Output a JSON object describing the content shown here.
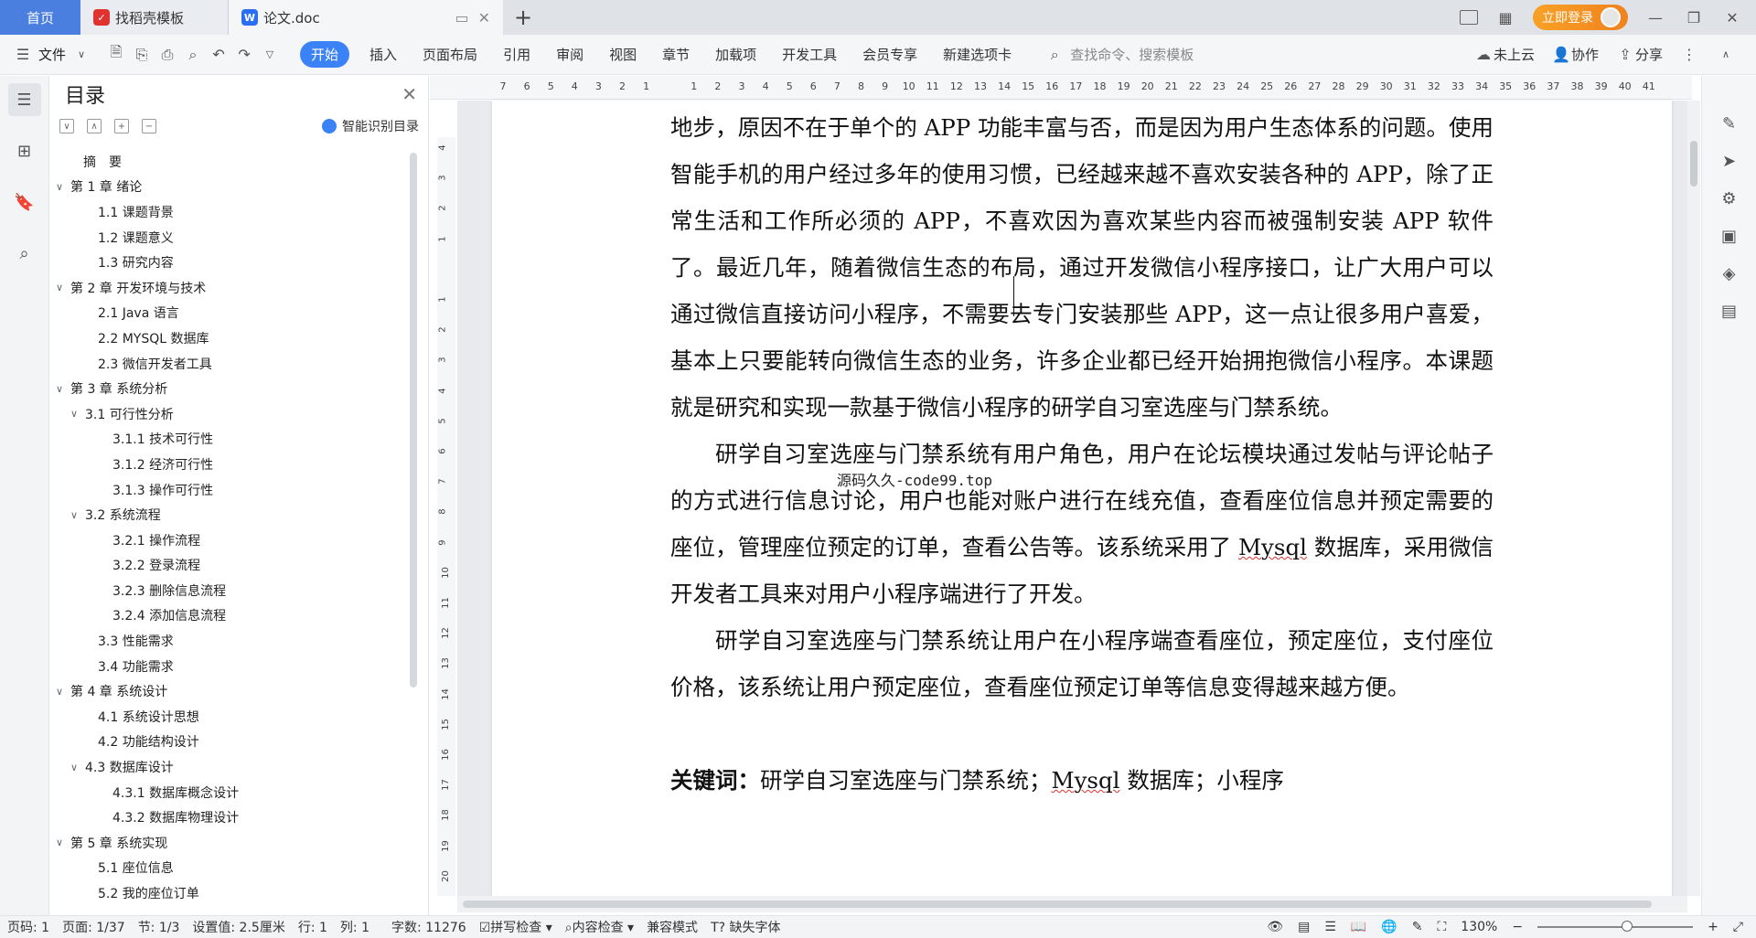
{
  "tabs": {
    "home": "首页",
    "template": "找稻壳模板",
    "doc": "论文.doc",
    "login": "立即登录"
  },
  "menu": {
    "file": "文件",
    "items": [
      "开始",
      "插入",
      "页面布局",
      "引用",
      "审阅",
      "视图",
      "章节",
      "加载项",
      "开发工具",
      "会员专享",
      "新建选项卡"
    ],
    "active": "开始",
    "search_placeholder": "查找命令、搜索模板",
    "cloud": "未上云",
    "collab": "协作",
    "share": "分享"
  },
  "toc": {
    "title": "目录",
    "smart": "智能识别目录",
    "items": [
      {
        "label": "摘　要",
        "level": 1,
        "chev": ""
      },
      {
        "label": "第 1 章  绪论",
        "level": 1,
        "chev": "v"
      },
      {
        "label": "1.1  课题背景",
        "level": 2,
        "chev": ""
      },
      {
        "label": "1.2  课题意义",
        "level": 2,
        "chev": ""
      },
      {
        "label": "1.3  研究内容",
        "level": 2,
        "chev": ""
      },
      {
        "label": "第 2 章  开发环境与技术",
        "level": 1,
        "chev": "v"
      },
      {
        "label": "2.1 Java 语言",
        "level": 2,
        "chev": ""
      },
      {
        "label": "2.2 MYSQL 数据库",
        "level": 2,
        "chev": ""
      },
      {
        "label": "2.3 微信开发者工具",
        "level": 2,
        "chev": ""
      },
      {
        "label": "第 3 章  系统分析",
        "level": 1,
        "chev": "v"
      },
      {
        "label": "3.1  可行性分析",
        "level": 2,
        "chev": "v"
      },
      {
        "label": "3.1.1  技术可行性",
        "level": 3,
        "chev": ""
      },
      {
        "label": "3.1.2  经济可行性",
        "level": 3,
        "chev": ""
      },
      {
        "label": "3.1.3  操作可行性",
        "level": 3,
        "chev": ""
      },
      {
        "label": "3.2  系统流程",
        "level": 2,
        "chev": "v"
      },
      {
        "label": "3.2.1  操作流程",
        "level": 3,
        "chev": ""
      },
      {
        "label": "3.2.2  登录流程",
        "level": 3,
        "chev": ""
      },
      {
        "label": "3.2.3  删除信息流程",
        "level": 3,
        "chev": ""
      },
      {
        "label": "3.2.4  添加信息流程",
        "level": 3,
        "chev": ""
      },
      {
        "label": "3.3  性能需求",
        "level": 2,
        "chev": ""
      },
      {
        "label": "3.4  功能需求",
        "level": 2,
        "chev": ""
      },
      {
        "label": "第 4 章  系统设计",
        "level": 1,
        "chev": "v"
      },
      {
        "label": "4.1  系统设计思想",
        "level": 2,
        "chev": ""
      },
      {
        "label": "4.2  功能结构设计",
        "level": 2,
        "chev": ""
      },
      {
        "label": "4.3  数据库设计",
        "level": 2,
        "chev": "v"
      },
      {
        "label": "4.3.1  数据库概念设计",
        "level": 3,
        "chev": ""
      },
      {
        "label": "4.3.2  数据库物理设计",
        "level": 3,
        "chev": ""
      },
      {
        "label": "第 5 章  系统实现",
        "level": 1,
        "chev": "v"
      },
      {
        "label": "5.1  座位信息",
        "level": 2,
        "chev": ""
      },
      {
        "label": "5.2  我的座位订单",
        "level": 2,
        "chev": ""
      }
    ]
  },
  "ruler": {
    "h": [
      "7",
      "6",
      "5",
      "4",
      "3",
      "2",
      "1",
      "",
      "1",
      "2",
      "3",
      "4",
      "5",
      "6",
      "7",
      "8",
      "9",
      "10",
      "11",
      "12",
      "13",
      "14",
      "15",
      "16",
      "17",
      "18",
      "19",
      "20",
      "21",
      "22",
      "23",
      "24",
      "25",
      "26",
      "27",
      "28",
      "29",
      "30",
      "31",
      "32",
      "33",
      "34",
      "35",
      "36",
      "37",
      "38",
      "39",
      "40",
      "41"
    ],
    "v": [
      "4",
      "3",
      "2",
      "1",
      "",
      "1",
      "2",
      "3",
      "4",
      "5",
      "6",
      "7",
      "8",
      "9",
      "10",
      "11",
      "12",
      "13",
      "14",
      "15",
      "16",
      "17",
      "18",
      "19",
      "20"
    ]
  },
  "document": {
    "p1": "地步，原因不在于单个的 APP 功能丰富与否，而是因为用户生态体系的问题。使用智能手机的用户经过多年的使用习惯，已经越来越不喜欢安装各种的 APP，除了正常生活和工作所必须的 APP，不喜欢因为喜欢某些内容而被强制安装 APP 软件了。最近几年，随着微信生态的布局，通过开发微信小程序接口，让广大用户可以通过微信直接访问小程序，不需要去专门安装那些 APP，这一点让很多用户喜爱，基本上只要能转向微信生态的业务，许多企业都已经开始拥抱微信小程序。本课题就是研究和实现一款基于微信小程序的研学自习室选座与门禁系统。",
    "p2a": "研学自习室选座与门禁系统有用户角色，用户在论坛模块通过发帖与评论帖子的方式进行信息讨论，用户也能对账户进行在线充值，查看座位信息并预定需要的座位，管理座位预定的订单，查看公告等。该系统采用了 ",
    "p2mysql": "Mysql",
    "p2b": " 数据库，采用微信开发者工具来对用户小程序端进行了开发。",
    "p3": "研学自习室选座与门禁系统让用户在小程序端查看座位，预定座位，支付座位价格，该系统让用户预定座位，查看座位预定订单等信息变得越来越方便。",
    "kw_label": "关键词：",
    "kw_a": "研学自习室选座与门禁系统；",
    "kw_mysql": "Mysql",
    "kw_b": " 数据库；小程序",
    "watermark": "源码久久-code99.top"
  },
  "status": {
    "page_code": "页码: 1",
    "page": "页面: 1/37",
    "section": "节: 1/3",
    "setting": "设置值: 2.5厘米",
    "row": "行: 1",
    "col": "列: 1",
    "words": "字数: 11276",
    "spell": "拼写检查",
    "content": "内容检查",
    "compat": "兼容模式",
    "missing_font": "缺失字体",
    "zoom": "130%"
  }
}
